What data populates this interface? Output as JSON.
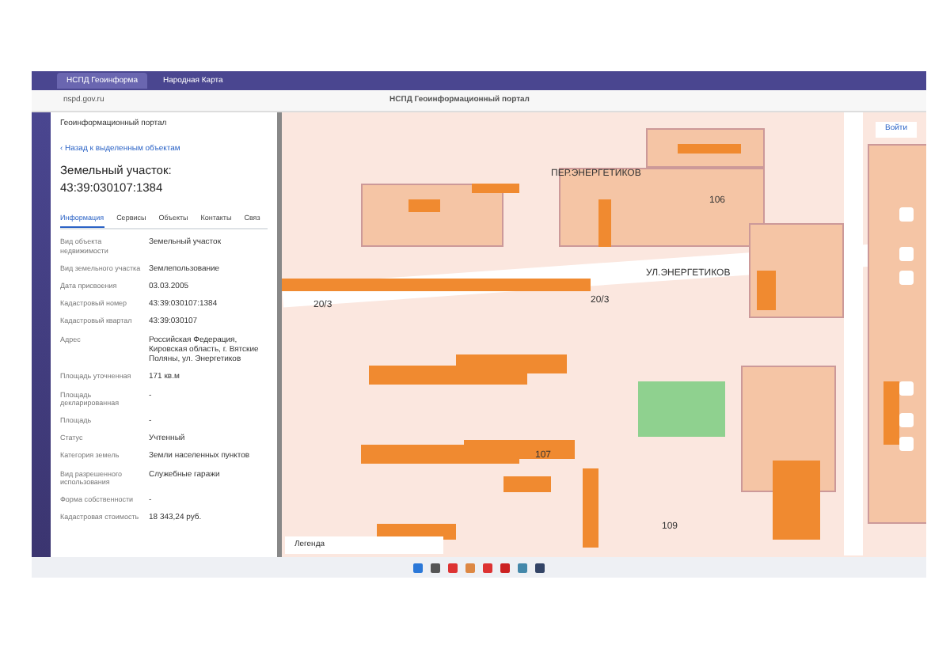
{
  "browser": {
    "tabs": [
      {
        "label": "НСПД Геоинформа",
        "selected": true
      },
      {
        "label": "Народная Карта",
        "selected": false
      }
    ],
    "address": "nspd.gov.ru",
    "page_title": "НСПД Геоинформационный портал"
  },
  "panel": {
    "portal_title": "Геоинформационный портал",
    "back_link": "‹ Назад к выделенным объектам",
    "heading": "Земельный участок: 43:39:030107:1384",
    "tabs": [
      {
        "label": "Информация",
        "selected": true
      },
      {
        "label": "Сервисы",
        "selected": false
      },
      {
        "label": "Объекты",
        "selected": false
      },
      {
        "label": "Контакты",
        "selected": false
      },
      {
        "label": "Связ",
        "selected": false
      }
    ],
    "rows": [
      {
        "label": "Вид объекта недвижимости",
        "value": "Земельный участок"
      },
      {
        "label": "Вид земельного участка",
        "value": "Землепользование"
      },
      {
        "label": "Дата присвоения",
        "value": "03.03.2005"
      },
      {
        "label": "Кадастровый номер",
        "value": "43:39:030107:1384"
      },
      {
        "label": "Кадастровый квартал",
        "value": "43:39:030107"
      },
      {
        "label": "Адрес",
        "value": "Российская Федерация, Кировская область, г. Вятские Поляны, ул. Энергетиков"
      },
      {
        "label": "Площадь уточненная",
        "value": "171 кв.м"
      },
      {
        "label": "Площадь декларированная",
        "value": "-"
      },
      {
        "label": "Площадь",
        "value": "-"
      },
      {
        "label": "Статус",
        "value": "Учтенный"
      },
      {
        "label": "Категория земель",
        "value": "Земли населенных пунктов"
      },
      {
        "label": "Вид разрешенного использования",
        "value": "Служебные гаражи"
      },
      {
        "label": "Форма собственности",
        "value": "-"
      },
      {
        "label": "Кадастровая стоимость",
        "value": "18 343,24 руб."
      }
    ]
  },
  "map": {
    "login": "Войти",
    "legend": "Легенда",
    "labels": [
      "ПЕР.ЭНЕРГЕТИКОВ",
      "УЛ.ЭНЕРГЕТИКОВ",
      "20/3",
      "20/3",
      "106",
      "107",
      "109"
    ]
  }
}
